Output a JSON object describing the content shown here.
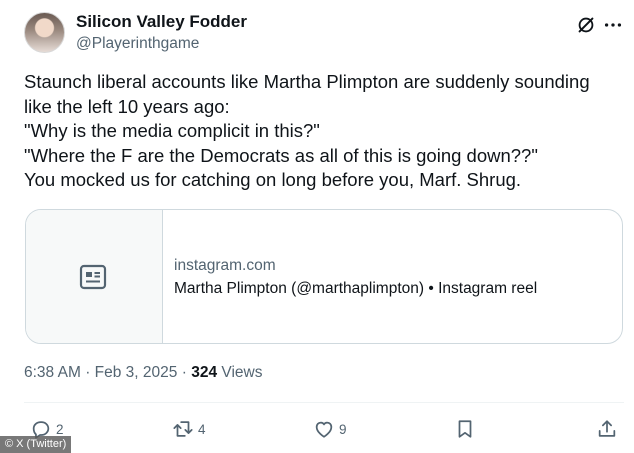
{
  "author": {
    "display_name": "Silicon Valley Fodder",
    "handle": "@Playerinthgame",
    "avatar_icon": "profile-photo"
  },
  "tweet": {
    "lines": [
      "Staunch liberal accounts like Martha Plimpton are suddenly sounding",
      "like the left 10 years ago:",
      "\"Why is the media complicit in this?\"",
      "\"Where the F are the Democrats as all of this is going down??\"",
      "You mocked us for catching on long before you, Marf. Shrug."
    ]
  },
  "card": {
    "domain": "instagram.com",
    "title": "Martha Plimpton (@marthaplimpton) • Instagram reel",
    "thumb_icon": "article-icon"
  },
  "meta": {
    "time": "6:38 AM",
    "separator": "·",
    "date": "Feb 3, 2025",
    "views_count": "324",
    "views_label": "Views"
  },
  "actions": {
    "reply_count": "2",
    "repost_count": "4",
    "like_count": "9"
  },
  "icons": [
    "grok-icon",
    "more-icon",
    "reply-icon",
    "repost-icon",
    "like-icon",
    "bookmark-icon",
    "share-icon"
  ],
  "watermark": "© X (Twitter)",
  "colors": {
    "text_primary": "#0f1419",
    "text_secondary": "#536471",
    "border": "#cfd9de",
    "card_thumb_bg": "#f7f9f9"
  }
}
